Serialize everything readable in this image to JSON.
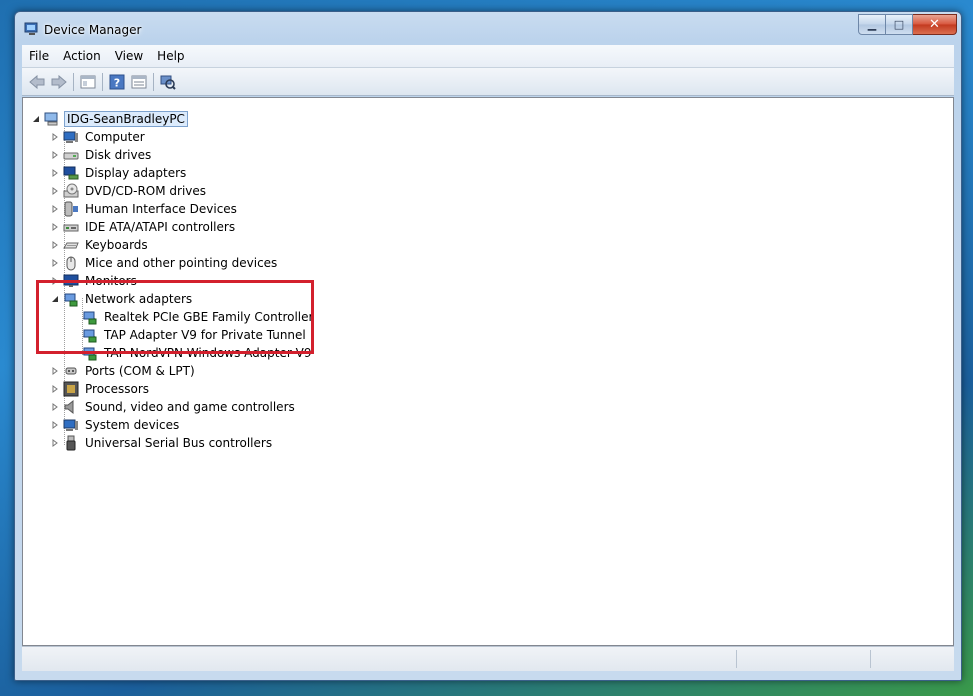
{
  "window": {
    "title": "Device Manager"
  },
  "menu": [
    "File",
    "Action",
    "View",
    "Help"
  ],
  "tree": {
    "root": "IDG-SeanBradleyPC",
    "categories": [
      {
        "label": "Computer",
        "icon": "computer-icon"
      },
      {
        "label": "Disk drives",
        "icon": "disk-drive-icon"
      },
      {
        "label": "Display adapters",
        "icon": "display-adapter-icon"
      },
      {
        "label": "DVD/CD-ROM drives",
        "icon": "dvd-drive-icon"
      },
      {
        "label": "Human Interface Devices",
        "icon": "hid-icon"
      },
      {
        "label": "IDE ATA/ATAPI controllers",
        "icon": "ide-controller-icon"
      },
      {
        "label": "Keyboards",
        "icon": "keyboard-icon"
      },
      {
        "label": "Mice and other pointing devices",
        "icon": "mouse-icon"
      },
      {
        "label": "Monitors",
        "icon": "monitor-icon"
      },
      {
        "label": "Network adapters",
        "icon": "network-adapter-icon"
      },
      {
        "label": "Ports (COM & LPT)",
        "icon": "port-icon"
      },
      {
        "label": "Processors",
        "icon": "processor-icon"
      },
      {
        "label": "Sound, video and game controllers",
        "icon": "sound-icon"
      },
      {
        "label": "System devices",
        "icon": "system-device-icon"
      },
      {
        "label": "Universal Serial Bus controllers",
        "icon": "usb-icon"
      }
    ],
    "network_children": [
      "Realtek PCIe GBE Family Controller",
      "TAP Adapter V9 for Private Tunnel",
      "TAP-NordVPN Windows Adapter V9"
    ]
  },
  "colors": {
    "highlight": "#d3202d",
    "selection": "#dcebfc"
  }
}
